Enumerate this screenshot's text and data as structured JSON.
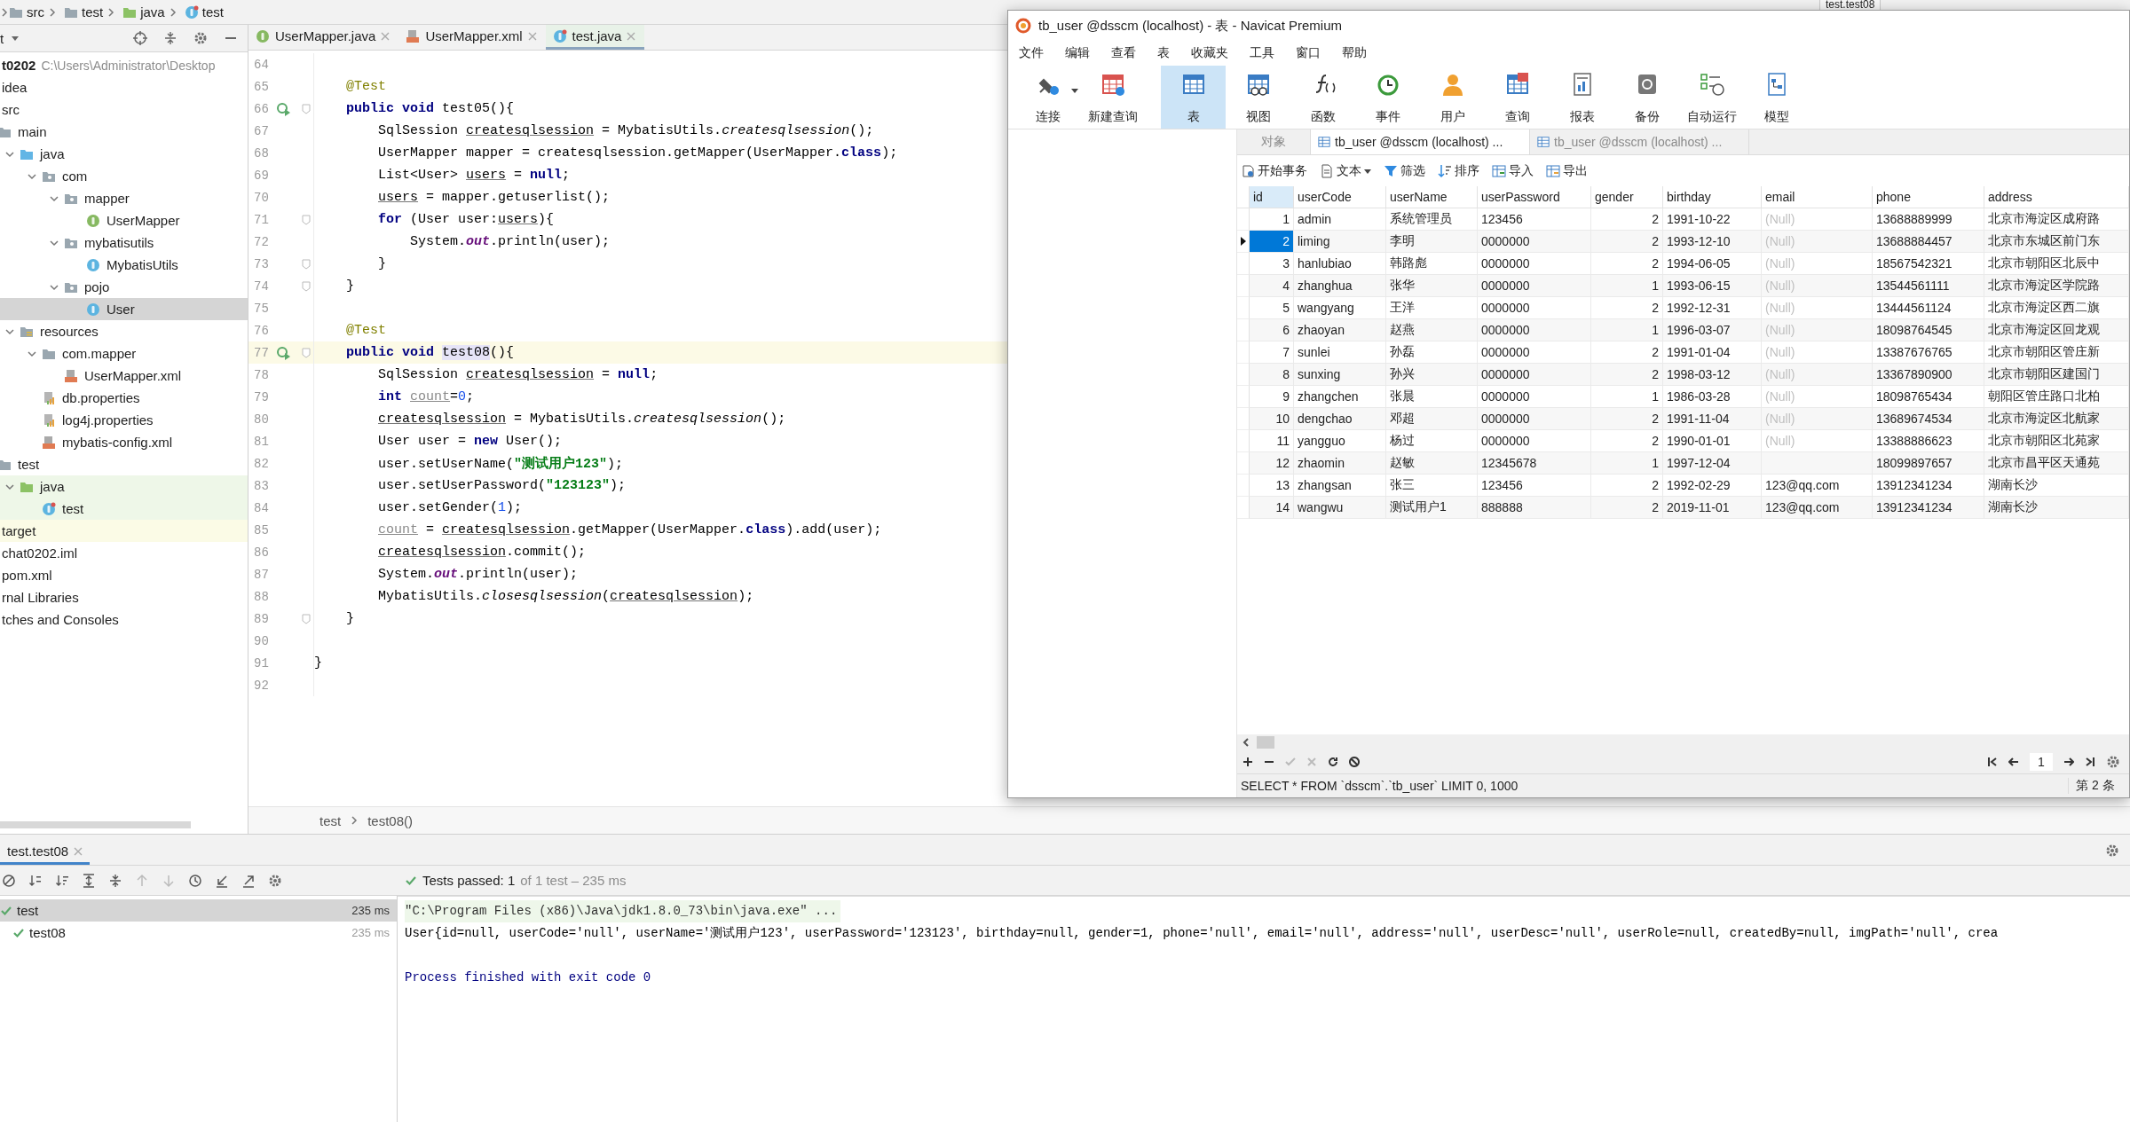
{
  "ide": {
    "breadcrumb": [
      "src",
      "test",
      "java",
      "test"
    ],
    "run_config": "test.test08",
    "project_view": {
      "title": "t",
      "tree": [
        {
          "label": "t0202",
          "path": "C:\\Users\\Administrator\\Desktop",
          "kind": "module",
          "selected": false,
          "children": [
            {
              "label": "idea",
              "selected": false
            },
            {
              "label": "src",
              "selected": false,
              "children": [
                {
                  "label": "main",
                  "kind": "folder",
                  "selected": false,
                  "children": [
                    {
                      "label": "java",
                      "kind": "source-root",
                      "expanded": true,
                      "selected": false,
                      "children": [
                        {
                          "label": "com",
                          "kind": "package",
                          "expanded": true,
                          "selected": false,
                          "children": [
                            {
                              "label": "mapper",
                              "kind": "package",
                              "expanded": true,
                              "selected": false,
                              "children": [
                                {
                                  "label": "UserMapper",
                                  "kind": "interface",
                                  "selected": false
                                }
                              ]
                            },
                            {
                              "label": "mybatisutils",
                              "kind": "package",
                              "expanded": true,
                              "selected": false,
                              "children": [
                                {
                                  "label": "MybatisUtils",
                                  "kind": "class",
                                  "selected": false
                                }
                              ]
                            },
                            {
                              "label": "pojo",
                              "kind": "package",
                              "expanded": true,
                              "selected": false,
                              "children": [
                                {
                                  "label": "User",
                                  "kind": "class",
                                  "selected": true
                                }
                              ]
                            }
                          ]
                        }
                      ]
                    },
                    {
                      "label": "resources",
                      "kind": "resources-root",
                      "expanded": true,
                      "selected": false,
                      "children": [
                        {
                          "label": "com.mapper",
                          "kind": "folder",
                          "expanded": true,
                          "selected": false,
                          "children": [
                            {
                              "label": "UserMapper.xml",
                              "kind": "xml-file",
                              "selected": false
                            }
                          ]
                        },
                        {
                          "label": "db.properties",
                          "kind": "properties-file",
                          "selected": false
                        },
                        {
                          "label": "log4j.properties",
                          "kind": "properties-file",
                          "selected": false
                        },
                        {
                          "label": "mybatis-config.xml",
                          "kind": "xml-file",
                          "selected": false
                        }
                      ]
                    }
                  ]
                },
                {
                  "label": "test",
                  "kind": "folder",
                  "selected": false,
                  "children": [
                    {
                      "label": "java",
                      "kind": "test-root",
                      "test_source": true,
                      "expanded": true,
                      "selected": false,
                      "children": [
                        {
                          "label": "test",
                          "kind": "test-class",
                          "test_source": true,
                          "selected": false
                        }
                      ]
                    }
                  ]
                }
              ]
            },
            {
              "label": "target",
              "excluded": true,
              "selected": false
            },
            {
              "label": "chat0202.iml",
              "selected": false
            },
            {
              "label": "pom.xml",
              "selected": false
            }
          ]
        },
        {
          "label": "rnal Libraries",
          "selected": false
        },
        {
          "label": "tches and Consoles",
          "selected": false
        }
      ]
    },
    "editor": {
      "tabs": [
        {
          "label": "UserMapper.java",
          "selected": false
        },
        {
          "label": "UserMapper.xml",
          "selected": false
        },
        {
          "label": "test.java",
          "selected": true
        }
      ],
      "lines": [
        {
          "number": "64"
        },
        {
          "number": "65",
          "segs": [
            {
              "kind": "ann",
              "text": "    @Test"
            }
          ]
        },
        {
          "number": "66",
          "run": true,
          "fold": true,
          "segs": [
            {
              "kind": "kw",
              "text": "    public void"
            },
            {
              "kind": "p",
              "text": " test05(){"
            }
          ]
        },
        {
          "number": "67",
          "segs": [
            {
              "kind": "p",
              "text": "        SqlSession "
            },
            {
              "kind": "ul",
              "text": "createsqlsession"
            },
            {
              "kind": "p",
              "text": " = MybatisUtils."
            },
            {
              "kind": "ital",
              "text": "createsqlsession"
            },
            {
              "kind": "p",
              "text": "();"
            }
          ]
        },
        {
          "number": "68",
          "segs": [
            {
              "kind": "p",
              "text": "        UserMapper mapper = createsqlsession.getMapper(UserMapper."
            },
            {
              "kind": "kw",
              "text": "class"
            },
            {
              "kind": "p",
              "text": ");"
            }
          ]
        },
        {
          "number": "69",
          "segs": [
            {
              "kind": "p",
              "text": "        List<User> "
            },
            {
              "kind": "ul",
              "text": "users"
            },
            {
              "kind": "p",
              "text": " = "
            },
            {
              "kind": "kw",
              "text": "null"
            },
            {
              "kind": "p",
              "text": ";"
            }
          ]
        },
        {
          "number": "70",
          "segs": [
            {
              "kind": "ul",
              "text": "        users"
            },
            {
              "kind": "p",
              "text": " = mapper.getuserlist();"
            }
          ]
        },
        {
          "number": "71",
          "fold": true,
          "segs": [
            {
              "kind": "kw",
              "text": "        for"
            },
            {
              "kind": "p",
              "text": " (User user:"
            },
            {
              "kind": "ul",
              "text": "users"
            },
            {
              "kind": "p",
              "text": "){"
            }
          ]
        },
        {
          "number": "72",
          "segs": [
            {
              "kind": "p",
              "text": "            System."
            },
            {
              "kind": "field",
              "text": "out"
            },
            {
              "kind": "p",
              "text": ".println(user);"
            }
          ]
        },
        {
          "number": "73",
          "fold": true,
          "segs": [
            {
              "kind": "p",
              "text": "        }"
            }
          ]
        },
        {
          "number": "74",
          "fold": true,
          "segs": [
            {
              "kind": "p",
              "text": "    }"
            }
          ]
        },
        {
          "number": "75"
        },
        {
          "number": "76",
          "segs": [
            {
              "kind": "ann",
              "text": "    @Test"
            }
          ]
        },
        {
          "number": "77",
          "run": true,
          "fold": true,
          "current": true,
          "segs": [
            {
              "kind": "kw",
              "text": "    public void "
            },
            {
              "kind": "hl",
              "text": "test08"
            },
            {
              "kind": "p",
              "text": "(){"
            }
          ]
        },
        {
          "number": "78",
          "segs": [
            {
              "kind": "p",
              "text": "        SqlSession "
            },
            {
              "kind": "ul",
              "text": "createsqlsession"
            },
            {
              "kind": "p",
              "text": " = "
            },
            {
              "kind": "kw",
              "text": "null"
            },
            {
              "kind": "p",
              "text": ";"
            }
          ]
        },
        {
          "number": "79",
          "segs": [
            {
              "kind": "kw",
              "text": "        int "
            },
            {
              "kind": "unused",
              "text": "count"
            },
            {
              "kind": "p",
              "text": "="
            },
            {
              "kind": "num",
              "text": "0"
            },
            {
              "kind": "p",
              "text": ";"
            }
          ]
        },
        {
          "number": "80",
          "segs": [
            {
              "kind": "ul",
              "text": "        createsqlsession"
            },
            {
              "kind": "p",
              "text": " = MybatisUtils."
            },
            {
              "kind": "ital",
              "text": "createsqlsession"
            },
            {
              "kind": "p",
              "text": "();"
            }
          ]
        },
        {
          "number": "81",
          "segs": [
            {
              "kind": "p",
              "text": "        User user = "
            },
            {
              "kind": "kw",
              "text": "new"
            },
            {
              "kind": "p",
              "text": " User();"
            }
          ]
        },
        {
          "number": "82",
          "segs": [
            {
              "kind": "p",
              "text": "        user.setUserName("
            },
            {
              "kind": "str",
              "text": "\"测试用户123\""
            },
            {
              "kind": "p",
              "text": ");"
            }
          ]
        },
        {
          "number": "83",
          "segs": [
            {
              "kind": "p",
              "text": "        user.setUserPassword("
            },
            {
              "kind": "str",
              "text": "\"123123\""
            },
            {
              "kind": "p",
              "text": ");"
            }
          ]
        },
        {
          "number": "84",
          "segs": [
            {
              "kind": "p",
              "text": "        user.setGender("
            },
            {
              "kind": "num",
              "text": "1"
            },
            {
              "kind": "p",
              "text": ");"
            }
          ]
        },
        {
          "number": "85",
          "segs": [
            {
              "kind": "unused",
              "text": "        count"
            },
            {
              "kind": "p",
              "text": " = "
            },
            {
              "kind": "ul",
              "text": "createsqlsession"
            },
            {
              "kind": "p",
              "text": ".getMapper(UserMapper."
            },
            {
              "kind": "kw",
              "text": "class"
            },
            {
              "kind": "p",
              "text": ").add(user);"
            }
          ]
        },
        {
          "number": "86",
          "segs": [
            {
              "kind": "ul",
              "text": "        createsqlsession"
            },
            {
              "kind": "p",
              "text": ".commit();"
            }
          ]
        },
        {
          "number": "87",
          "segs": [
            {
              "kind": "p",
              "text": "        System."
            },
            {
              "kind": "field",
              "text": "out"
            },
            {
              "kind": "p",
              "text": ".println(user);"
            }
          ]
        },
        {
          "number": "88",
          "segs": [
            {
              "kind": "p",
              "text": "        MybatisUtils."
            },
            {
              "kind": "ital",
              "text": "closesqlsession"
            },
            {
              "kind": "p",
              "text": "("
            },
            {
              "kind": "ul",
              "text": "createsqlsession"
            },
            {
              "kind": "p",
              "text": ");"
            }
          ]
        },
        {
          "number": "89",
          "fold": true,
          "segs": [
            {
              "kind": "p",
              "text": "    }"
            }
          ]
        },
        {
          "number": "90"
        },
        {
          "number": "91",
          "segs": [
            {
              "kind": "p",
              "text": "}"
            }
          ]
        },
        {
          "number": "92"
        }
      ],
      "breadcrumb": [
        "test",
        "test08()"
      ]
    },
    "run_panel": {
      "tab": "test.test08",
      "summary": "Tests passed: 1",
      "detail": "of 1 test – 235 ms",
      "tests": [
        {
          "name": "test",
          "time": "235 ms",
          "passed": true,
          "selected": true,
          "children": [
            {
              "name": "test08",
              "time": "235 ms",
              "passed": true,
              "selected": false
            }
          ]
        }
      ],
      "console": [
        {
          "kind": "command",
          "text": "\"C:\\Program Files (x86)\\Java\\jdk1.8.0_73\\bin\\java.exe\" ..."
        },
        {
          "kind": "output",
          "text": "User{id=null, userCode='null', userName='测试用户123', userPassword='123123', birthday=null, gender=1, phone='null', email='null', address='null', userDesc='null', userRole=null, createdBy=null, imgPath='null', crea"
        },
        {
          "kind": "exit",
          "text": "Process finished with exit code 0"
        }
      ]
    }
  },
  "navicat": {
    "title": "tb_user @dsscm (localhost) - 表 - Navicat Premium",
    "menu": [
      "文件",
      "编辑",
      "查看",
      "表",
      "收藏夹",
      "工具",
      "窗口",
      "帮助"
    ],
    "toolbar": [
      {
        "label": "连接",
        "selected": false,
        "dropdown": true
      },
      {
        "label": "新建查询",
        "selected": false
      },
      {
        "label": "表",
        "selected": true
      },
      {
        "label": "视图",
        "selected": false
      },
      {
        "label": "函数",
        "selected": false
      },
      {
        "label": "事件",
        "selected": false
      },
      {
        "label": "用户",
        "selected": false
      },
      {
        "label": "查询",
        "selected": false
      },
      {
        "label": "报表",
        "selected": false
      },
      {
        "label": "备份",
        "selected": false
      },
      {
        "label": "自动运行",
        "selected": false
      },
      {
        "label": "模型",
        "selected": false
      }
    ],
    "tabs": [
      {
        "label": "对象",
        "selected": false
      },
      {
        "label": "tb_user @dsscm (localhost) ...",
        "selected": true
      },
      {
        "label": "tb_user @dsscm (localhost) ...",
        "selected": false
      }
    ],
    "actions": [
      {
        "label": "开始事务"
      },
      {
        "label": "文本",
        "dropdown": true
      },
      {
        "label": "筛选"
      },
      {
        "label": "排序"
      },
      {
        "label": "导入"
      },
      {
        "label": "导出"
      }
    ],
    "columns": [
      {
        "label": "id",
        "selected": true
      },
      {
        "label": "userCode",
        "selected": false
      },
      {
        "label": "userName",
        "selected": false
      },
      {
        "label": "userPassword",
        "selected": false
      },
      {
        "label": "gender",
        "selected": false
      },
      {
        "label": "birthday",
        "selected": false
      },
      {
        "label": "email",
        "selected": false
      },
      {
        "label": "phone",
        "selected": false
      },
      {
        "label": "address",
        "selected": false
      }
    ],
    "rows": [
      {
        "selected": false,
        "cells": [
          "1",
          "admin",
          "系统管理员",
          "123456",
          "2",
          "1991-10-22",
          {
            "text": "(Null)",
            "null": true
          },
          "13688889999",
          "北京市海淀区成府路"
        ]
      },
      {
        "selected": true,
        "cells": [
          "2",
          "liming",
          "李明",
          "0000000",
          "2",
          "1993-12-10",
          {
            "text": "(Null)",
            "null": true
          },
          "13688884457",
          "北京市东城区前门东"
        ]
      },
      {
        "selected": false,
        "cells": [
          "3",
          "hanlubiao",
          "韩路彪",
          "0000000",
          "2",
          "1994-06-05",
          {
            "text": "(Null)",
            "null": true
          },
          "18567542321",
          "北京市朝阳区北辰中"
        ]
      },
      {
        "selected": false,
        "cells": [
          "4",
          "zhanghua",
          "张华",
          "0000000",
          "1",
          "1993-06-15",
          {
            "text": "(Null)",
            "null": true
          },
          "13544561111",
          "北京市海淀区学院路"
        ]
      },
      {
        "selected": false,
        "cells": [
          "5",
          "wangyang",
          "王洋",
          "0000000",
          "2",
          "1992-12-31",
          {
            "text": "(Null)",
            "null": true
          },
          "13444561124",
          "北京市海淀区西二旗"
        ]
      },
      {
        "selected": false,
        "cells": [
          "6",
          "zhaoyan",
          "赵燕",
          "0000000",
          "1",
          "1996-03-07",
          {
            "text": "(Null)",
            "null": true
          },
          "18098764545",
          "北京市海淀区回龙观"
        ]
      },
      {
        "selected": false,
        "cells": [
          "7",
          "sunlei",
          "孙磊",
          "0000000",
          "2",
          "1991-01-04",
          {
            "text": "(Null)",
            "null": true
          },
          "13387676765",
          "北京市朝阳区管庄新"
        ]
      },
      {
        "selected": false,
        "cells": [
          "8",
          "sunxing",
          "孙兴",
          "0000000",
          "2",
          "1998-03-12",
          {
            "text": "(Null)",
            "null": true
          },
          "13367890900",
          "北京市朝阳区建国门"
        ]
      },
      {
        "selected": false,
        "cells": [
          "9",
          "zhangchen",
          "张晨",
          "0000000",
          "1",
          "1986-03-28",
          {
            "text": "(Null)",
            "null": true
          },
          "18098765434",
          "朝阳区管庄路口北柏"
        ]
      },
      {
        "selected": false,
        "cells": [
          "10",
          "dengchao",
          "邓超",
          "0000000",
          "2",
          "1991-11-04",
          {
            "text": "(Null)",
            "null": true
          },
          "13689674534",
          "北京市海淀区北航家"
        ]
      },
      {
        "selected": false,
        "cells": [
          "11",
          "yangguo",
          "杨过",
          "0000000",
          "2",
          "1990-01-01",
          {
            "text": "(Null)",
            "null": true
          },
          "13388886623",
          "北京市朝阳区北苑家"
        ]
      },
      {
        "selected": false,
        "cells": [
          "12",
          "zhaomin",
          "赵敏",
          "12345678",
          "1",
          "1997-12-04",
          null,
          "18099897657",
          "北京市昌平区天通苑"
        ]
      },
      {
        "selected": false,
        "cells": [
          "13",
          "zhangsan",
          "张三",
          "123456",
          "2",
          "1992-02-29",
          "123@qq.com",
          "13912341234",
          "湖南长沙"
        ]
      },
      {
        "selected": false,
        "cells": [
          "14",
          "wangwu",
          "测试用户1",
          "888888",
          "2",
          "2019-11-01",
          "123@qq.com",
          "13912341234",
          "湖南长沙"
        ]
      }
    ],
    "page": "1",
    "sql": "SELECT * FROM `dsscm`.`tb_user` LIMIT 0, 1000",
    "record": "第 2 条"
  }
}
